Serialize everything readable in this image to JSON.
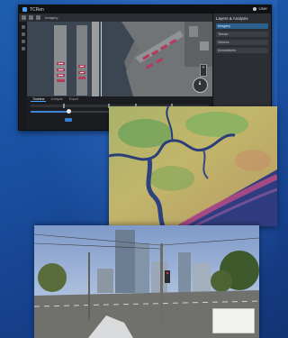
{
  "window": {
    "title": "TCRen",
    "user_label": "User",
    "toolbar_label": "Imagery",
    "panel_title": "Layers & Analysis",
    "panel_items": [
      "Imagery",
      "Terrain",
      "Vectors",
      "Annotations"
    ],
    "selected_panel_item": 0
  },
  "timeline": {
    "tabs": [
      "Timeline",
      "Analysis",
      "Export"
    ],
    "active_tab": 0,
    "marker_labels": [
      "",
      "",
      "",
      ""
    ],
    "progress_percent": 30
  },
  "colors": {
    "background": "#1a4fa0",
    "accent": "#3e86d8",
    "window_bg": "#1f2226"
  },
  "icons": [
    "compass-icon",
    "zoom-icon",
    "layer-icon",
    "user-avatar-icon"
  ]
}
